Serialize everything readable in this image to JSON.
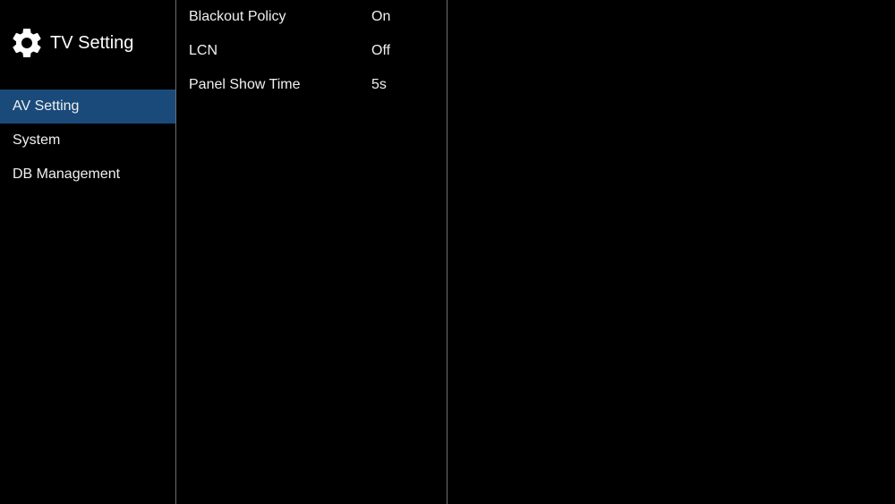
{
  "sidebar": {
    "title": "TV Setting",
    "items": [
      {
        "label": "AV Setting",
        "selected": true
      },
      {
        "label": "System",
        "selected": false
      },
      {
        "label": "DB Management",
        "selected": false
      }
    ]
  },
  "settings": [
    {
      "label": "Blackout Policy",
      "value": "On"
    },
    {
      "label": "LCN",
      "value": "Off"
    },
    {
      "label": "Panel Show Time",
      "value": "5s"
    }
  ]
}
